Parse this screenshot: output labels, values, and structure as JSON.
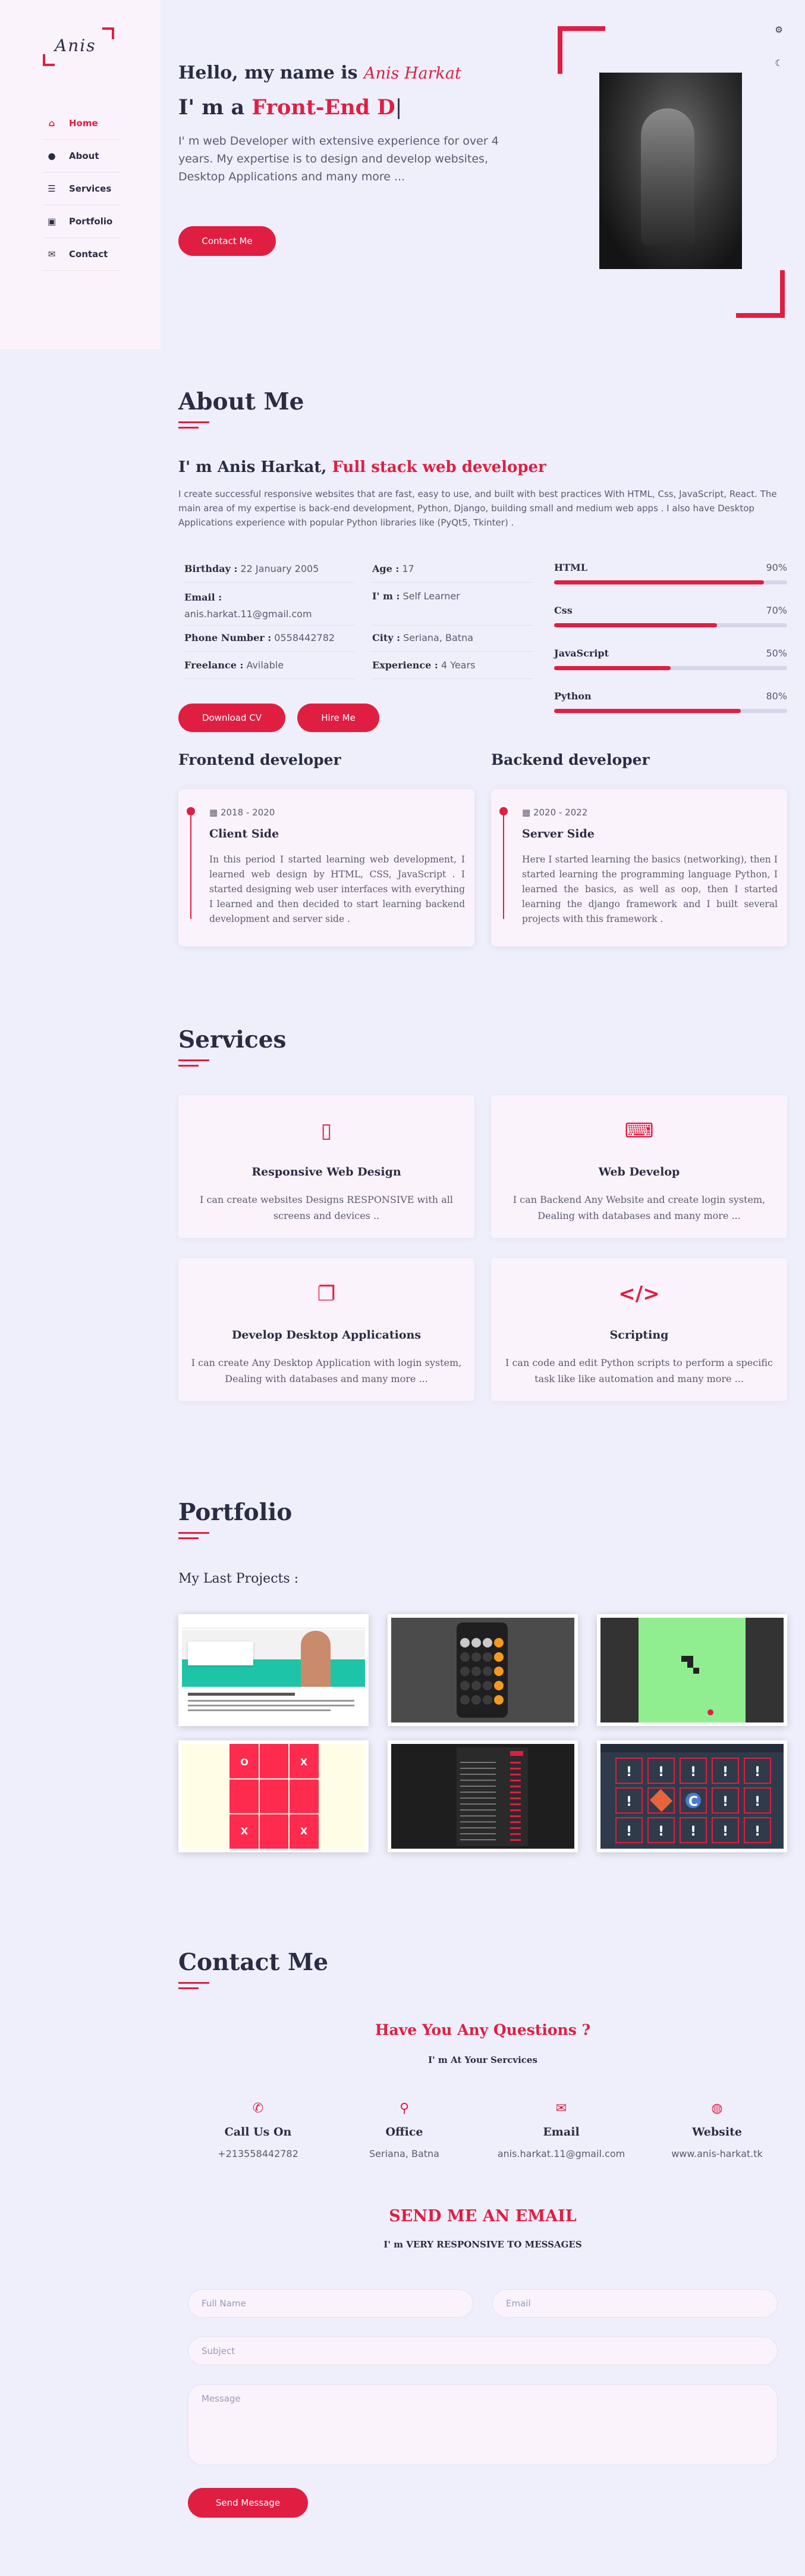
{
  "logo": "Anis",
  "nav": [
    {
      "icon": "home-icon",
      "glyph": "⌂",
      "label": "Home"
    },
    {
      "icon": "user-icon",
      "glyph": "●",
      "label": "About"
    },
    {
      "icon": "list-icon",
      "glyph": "☰",
      "label": "Services"
    },
    {
      "icon": "briefcase-icon",
      "glyph": "▣",
      "label": "Portfolio"
    },
    {
      "icon": "chat-icon",
      "glyph": "✉",
      "label": "Contact"
    }
  ],
  "hero": {
    "hello": "Hello, my name is",
    "name": "Anis Harkat",
    "im": "I' m a",
    "typed": "Front-End D",
    "cursor": "|",
    "intro": "I' m web Developer with extensive experience for over 4 years. My expertise is to design and develop websites, Desktop Applications and many more ...",
    "button": "Contact Me"
  },
  "about": {
    "title": "About Me",
    "heading": "I' m Anis Harkat,",
    "heading_red": "Full stack web developer",
    "paragraph": "I create successful responsive websites that are fast, easy to use, and built with best practices With HTML, Css, JavaScript, React. The main area of my expertise is back-end development, Python, Django, building small and medium web apps . I also have Desktop Applications experience with popular Python libraries like (PyQt5, Tkinter) .",
    "info": [
      {
        "label": "Birthday :",
        "value": "22 January 2005"
      },
      {
        "label": "Age :",
        "value": "17"
      },
      {
        "label": "Email :",
        "value": "anis.harkat.11@gmail.com"
      },
      {
        "label": "I' m :",
        "value": "Self Learner"
      },
      {
        "label": "Phone Number :",
        "value": "0558442782"
      },
      {
        "label": "City :",
        "value": "Seriana, Batna"
      },
      {
        "label": "Freelance :",
        "value": "Avilable"
      },
      {
        "label": "Experience :",
        "value": "4 Years"
      }
    ],
    "skills": [
      {
        "name": "HTML",
        "percent": "90%",
        "level": 0.9
      },
      {
        "name": "Css",
        "percent": "70%",
        "level": 0.7
      },
      {
        "name": "JavaScript",
        "percent": "50%",
        "level": 0.5
      },
      {
        "name": "Python",
        "percent": "80%",
        "level": 0.8
      }
    ],
    "download_cv": "Download CV",
    "hire_me": "Hire Me",
    "frontend_title": "Frontend developer",
    "backend_title": "Backend developer",
    "timeline": [
      {
        "date": "2018 - 2020",
        "title": "Client Side",
        "text": "In this period I started learning web development, I learned web design by HTML, CSS, JavaScript . I started designing web user interfaces with everything I learned and then decided to start learning backend development and server side ."
      },
      {
        "date": "2020 - 2022",
        "title": "Server Side",
        "text": "Here I started learning the basics (networking), then I started learning the programming language Python, I learned the basics, as well as oop, then I started learning the django framework and I built several projects with this framework ."
      }
    ]
  },
  "services": {
    "title": "Services",
    "items": [
      {
        "icon": "mobile-icon",
        "glyph": "▯",
        "title": "Responsive Web Design",
        "desc": "I can create websites Designs RESPONSIVE with all screens and devices .."
      },
      {
        "icon": "laptop-code-icon",
        "glyph": "⌨",
        "title": "Web Develop",
        "desc": "I can Backend Any Website and create login system, Dealing with databases and many more ..."
      },
      {
        "icon": "copy-icon",
        "glyph": "❐",
        "title": "Develop Desktop Applications",
        "desc": "I can create Any Desktop Application with login system, Dealing with databases and many more ..."
      },
      {
        "icon": "code-icon",
        "glyph": "</>",
        "title": "Scripting",
        "desc": "I can code and edit Python scripts to perform a specific task like like automation and many more ..."
      }
    ]
  },
  "portfolio": {
    "title": "Portfolio",
    "subtitle": "My Last Projects :",
    "projects": [
      {
        "name": "udemy-clone"
      },
      {
        "name": "calculator"
      },
      {
        "name": "snake-game"
      },
      {
        "name": "tic-tac-toe"
      },
      {
        "name": "dark-table-app"
      },
      {
        "name": "memory-game"
      }
    ],
    "ttt": [
      "O",
      "",
      "X",
      "",
      "",
      "",
      "X",
      "",
      "X"
    ]
  },
  "contact": {
    "title": "Contact Me",
    "question": "Have You Any Questions ?",
    "service": "I' m At Your Sercvices",
    "items": [
      {
        "icon": "phone-icon",
        "glyph": "✆",
        "label": "Call Us On",
        "value": "+213558442782"
      },
      {
        "icon": "location-icon",
        "glyph": "⚲",
        "label": "Office",
        "value": "Seriana, Batna"
      },
      {
        "icon": "envelope-icon",
        "glyph": "✉",
        "label": "Email",
        "value": "anis.harkat.11@gmail.com"
      },
      {
        "icon": "globe-icon",
        "glyph": "◍",
        "label": "Website",
        "value": "www.anis-harkat.tk"
      }
    ],
    "email_title": "SEND ME AN EMAIL",
    "email_sub": "I' m VERY RESPONSIVE TO MESSAGES",
    "form": {
      "name_ph": "Full Name",
      "email_ph": "Email",
      "subject_ph": "Subject",
      "message_ph": "Message",
      "send": "Send Message"
    }
  },
  "theme": {
    "accent": "#e01e42",
    "bg": "#eeeffb",
    "sidebar": "#fbf3fb",
    "dark": "#2b2c43"
  }
}
